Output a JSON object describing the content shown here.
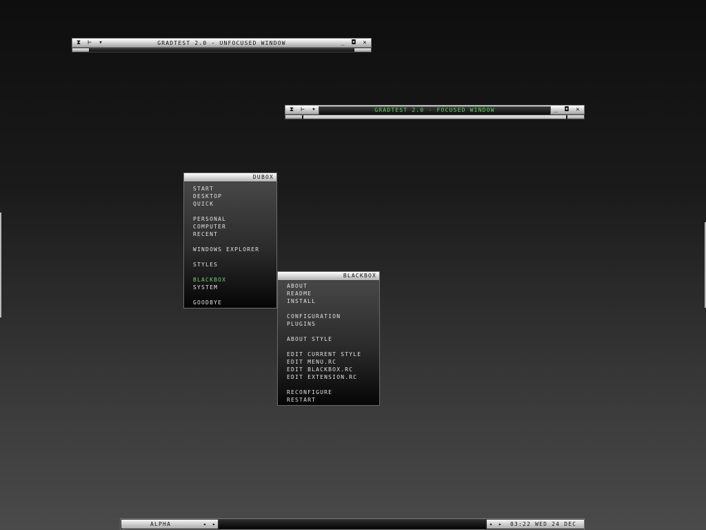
{
  "unfocused_window": {
    "title": "GRADTEST 2.0 - UNFOCUSED WINDOW",
    "left_icons": [
      "pin-icon",
      "arrow-right-icon",
      "dropdown-icon"
    ],
    "right_icons": [
      "minimize-icon",
      "maximize-icon",
      "close-icon"
    ]
  },
  "focused_window": {
    "title": "GRADTEST 2.0 - FOCUSED WINDOW",
    "title_color": "#5fd35f"
  },
  "symbols": {
    "pin": "⧗",
    "stick": "⊢",
    "menu": "▾",
    "minimize": "_",
    "maximize": "◘",
    "close": "✕",
    "left": "◂",
    "right": "▸"
  },
  "main_menu": {
    "title": "DUBOX",
    "groups": [
      [
        "START",
        "DESKTOP",
        "QUICK"
      ],
      [
        "PERSONAL",
        "COMPUTER",
        "RECENT"
      ],
      [
        "WINDOWS EXPLORER"
      ],
      [
        "STYLES"
      ],
      [
        "BLACKBOX",
        "SYSTEM"
      ],
      [
        "GOODBYE"
      ]
    ],
    "active_item": "BLACKBOX",
    "active_color": "#6fd36f"
  },
  "blackbox_menu": {
    "title": "BLACKBOX",
    "groups": [
      [
        "ABOUT",
        "README",
        "INSTALL"
      ],
      [
        "CONFIGURATION",
        "PLUGINS"
      ],
      [
        "ABOUT STYLE"
      ],
      [
        "EDIT CURRENT STYLE",
        "EDIT MENU.RC",
        "EDIT BLACKBOX.RC",
        "EDIT EXTENSION.RC"
      ],
      [
        "RECONFIGURE",
        "RESTART"
      ]
    ]
  },
  "taskbar": {
    "workspace": "ALPHA",
    "clock": "03:22 WED 24 DEC"
  }
}
